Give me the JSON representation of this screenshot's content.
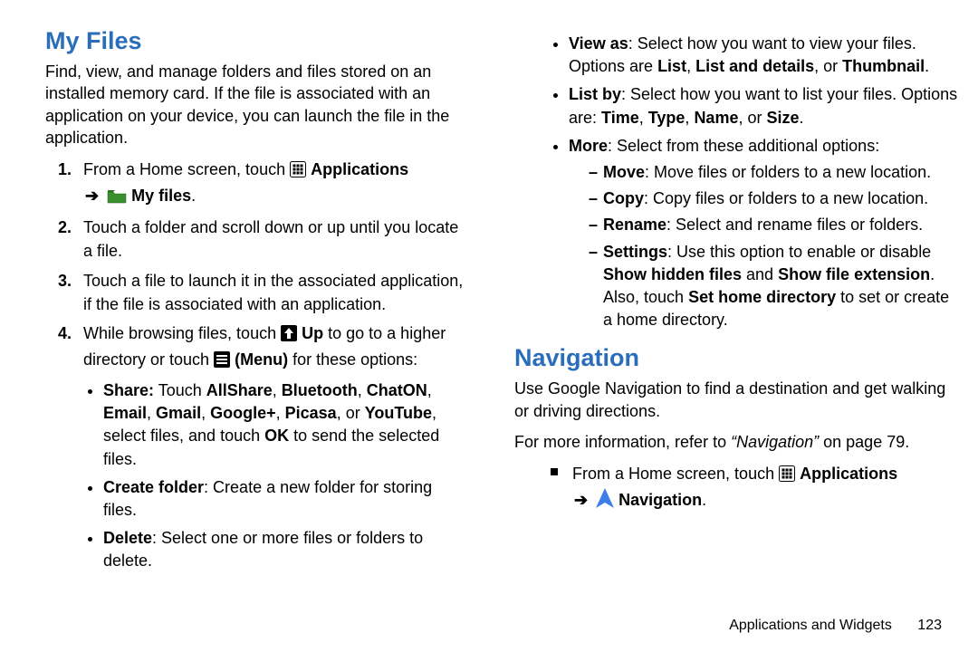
{
  "left": {
    "heading": "My Files",
    "intro": "Find, view, and manage folders and files stored on an installed memory card. If the file is associated with an application on your device, you can launch the file in the application.",
    "step1_a": "From a Home screen, touch ",
    "step1_apps": " Applications",
    "step1_myfiles": " My files",
    "step1_dot": ".",
    "step2": "Touch a folder and scroll down or up until you locate a file.",
    "step3": "Touch a file to launch it in the associated application, if the file is associated with an application.",
    "step4_a": "While browsing files, touch ",
    "step4_up": " Up",
    "step4_b": " to go to a higher directory or touch ",
    "step4_menu": " (Menu)",
    "step4_c": " for these options:",
    "sub_share_label": "Share:",
    "sub_share_a": " Touch ",
    "sub_share_apps": "AllShare",
    "sub_share_c1": ", ",
    "sub_share_bt": "Bluetooth",
    "sub_share_c2": ", ",
    "sub_share_chaton": "ChatON",
    "sub_share_c3": ", ",
    "sub_share_email": "Email",
    "sub_share_c4": ", ",
    "sub_share_gmail": "Gmail",
    "sub_share_c5": ", ",
    "sub_share_gplus": "Google+",
    "sub_share_c6": ", ",
    "sub_share_picasa": "Picasa",
    "sub_share_or": ", or ",
    "sub_share_yt": "YouTube",
    "sub_share_mid": ", select files, and touch ",
    "sub_share_ok": "OK",
    "sub_share_end": " to send the selected files.",
    "sub_create_label": "Create folder",
    "sub_create_text": ": Create a new folder for storing files.",
    "sub_delete_label": "Delete",
    "sub_delete_text": ": Select one or more files or folders to delete."
  },
  "right": {
    "viewas_label": "View as",
    "viewas_a": ": Select how you want to view your files. Options are ",
    "viewas_list": "List",
    "viewas_c1": ", ",
    "viewas_ld": "List and details",
    "viewas_or": ", or ",
    "viewas_thumb": "Thumbnail",
    "viewas_dot": ".",
    "listby_label": "List by",
    "listby_a": ": Select how you want to list your files. Options are: ",
    "listby_time": "Time",
    "listby_c1": ", ",
    "listby_type": "Type",
    "listby_c2": ", ",
    "listby_name": "Name",
    "listby_or": ", or ",
    "listby_size": "Size",
    "listby_dot": ".",
    "more_label": "More",
    "more_text": ": Select from these additional options:",
    "more_move_label": "Move",
    "more_move_text": ": Move files or folders to a new location.",
    "more_copy_label": "Copy",
    "more_copy_text": ": Copy files or folders to a new location.",
    "more_rename_label": "Rename",
    "more_rename_text": ": Select and rename files or folders.",
    "more_settings_label": "Settings",
    "more_settings_a": ": Use this option to enable or disable ",
    "more_settings_sh": "Show hidden files",
    "more_settings_and": " and ",
    "more_settings_ext": "Show file extension",
    "more_settings_mid": ". Also, touch ",
    "more_settings_home": "Set home directory",
    "more_settings_end": " to set or create a home directory.",
    "nav_heading": "Navigation",
    "nav_intro": "Use Google Navigation to find a destination and get walking or driving directions.",
    "nav_ref_a": "For more information, refer to ",
    "nav_ref_i": "“Navigation”",
    "nav_ref_b": " on page 79.",
    "nav_step_a": "From a Home screen, touch ",
    "nav_step_apps": " Applications",
    "nav_step_nav": " Navigation",
    "nav_step_dot": "."
  },
  "footer": {
    "section": "Applications and Widgets",
    "page": "123"
  },
  "glyph": {
    "arrow": "➔"
  }
}
